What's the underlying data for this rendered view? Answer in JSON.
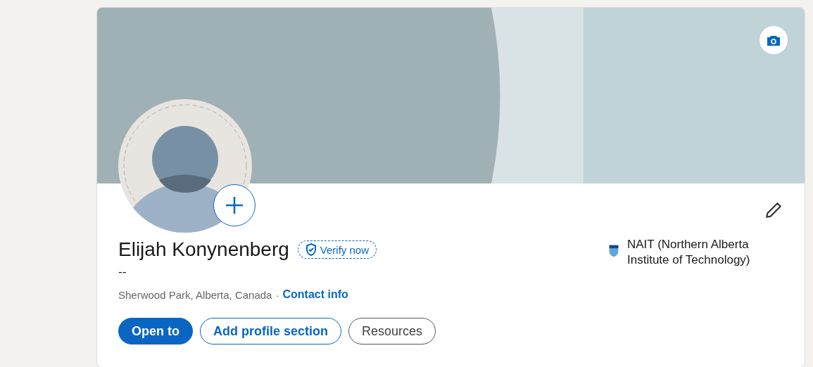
{
  "profile": {
    "name": "Elijah Konynenberg",
    "verify_label": "Verify now",
    "headline": "--",
    "location": "Sherwood Park, Alberta, Canada",
    "separator": "·",
    "contact_link": "Contact info"
  },
  "education": {
    "school": "NAIT (Northern Alberta Institute of Technology)"
  },
  "actions": [
    {
      "label": "Open to",
      "kind": "primary"
    },
    {
      "label": "Add profile section",
      "kind": "secondary"
    },
    {
      "label": "Resources",
      "kind": "tertiary"
    }
  ]
}
